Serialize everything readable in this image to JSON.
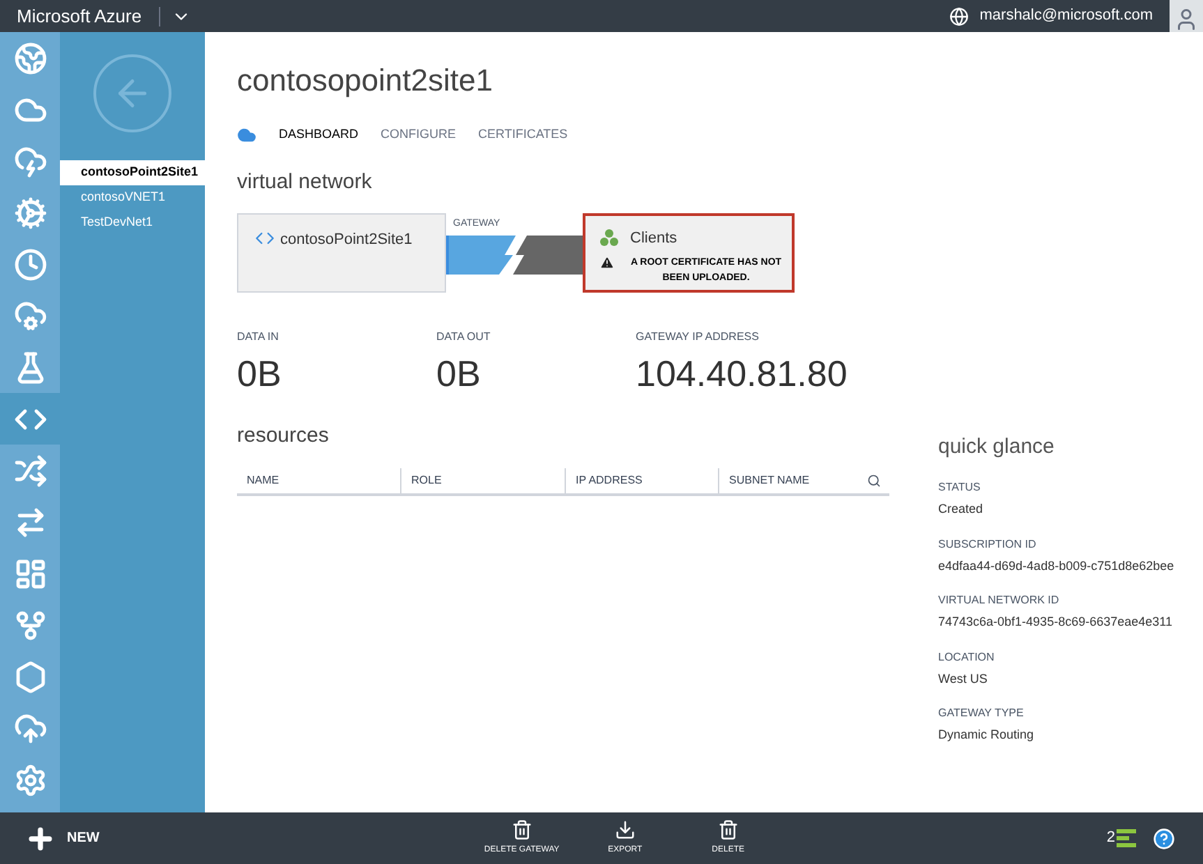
{
  "top_bar": {
    "brand": "Microsoft Azure",
    "user": "marshalc@microsoft.com"
  },
  "rail": [
    {
      "kind": "web",
      "selected": false
    },
    {
      "kind": "cloud",
      "selected": false
    },
    {
      "kind": "mobile",
      "selected": false
    },
    {
      "kind": "batch",
      "selected": false
    },
    {
      "kind": "scheduler",
      "selected": false
    },
    {
      "kind": "remote",
      "selected": false
    },
    {
      "kind": "lab",
      "selected": false
    },
    {
      "kind": "network",
      "selected": true
    },
    {
      "kind": "traffic",
      "selected": false
    },
    {
      "kind": "connect",
      "selected": false
    },
    {
      "kind": "dashboard",
      "selected": false
    },
    {
      "kind": "git",
      "selected": false
    },
    {
      "kind": "services",
      "selected": false
    },
    {
      "kind": "storage",
      "selected": false
    },
    {
      "kind": "settings",
      "selected": false
    }
  ],
  "networks": [
    {
      "label": "contosoPoint2Site1",
      "selected": true
    },
    {
      "label": "contosoVNET1",
      "selected": false
    },
    {
      "label": "TestDevNet1",
      "selected": false
    }
  ],
  "page_title": "contosopoint2site1",
  "tabs": [
    {
      "label": "DASHBOARD",
      "selected": true
    },
    {
      "label": "CONFIGURE",
      "selected": false
    },
    {
      "label": "CERTIFICATES",
      "selected": false
    }
  ],
  "virtual_network": {
    "heading": "virtual network",
    "network": "contosoPoint2Site1",
    "gateway_label": "GATEWAY",
    "clients": "Clients",
    "warning": "A ROOT CERTIFICATE HAS NOT BEEN UPLOADED."
  },
  "stats": [
    {
      "label": "DATA IN",
      "value": "0B"
    },
    {
      "label": "DATA OUT",
      "value": "0B"
    },
    {
      "label": "GATEWAY IP ADDRESS",
      "value": "104.40.81.80"
    }
  ],
  "resources": {
    "heading": "resources",
    "columns": [
      "NAME",
      "ROLE",
      "IP ADDRESS",
      "SUBNET NAME"
    ]
  },
  "quick_glance": {
    "heading": "quick glance",
    "items": [
      {
        "label": "STATUS",
        "value": "Created"
      },
      {
        "label": "SUBSCRIPTION ID",
        "value": "e4dfaa44-d69d-4ad8-b009-c751d8e62bee"
      },
      {
        "label": "VIRTUAL NETWORK ID",
        "value": "74743c6a-0bf1-4935-8c69-6637eae4e311"
      },
      {
        "label": "LOCATION",
        "value": "West US"
      },
      {
        "label": "GATEWAY TYPE",
        "value": "Dynamic Routing"
      }
    ]
  },
  "bottom_bar": {
    "new": "NEW",
    "actions": [
      {
        "label": "DELETE GATEWAY",
        "kind": "delete"
      },
      {
        "label": "EXPORT",
        "kind": "export"
      },
      {
        "label": "DELETE",
        "kind": "delete"
      }
    ],
    "notification_count": "2"
  }
}
